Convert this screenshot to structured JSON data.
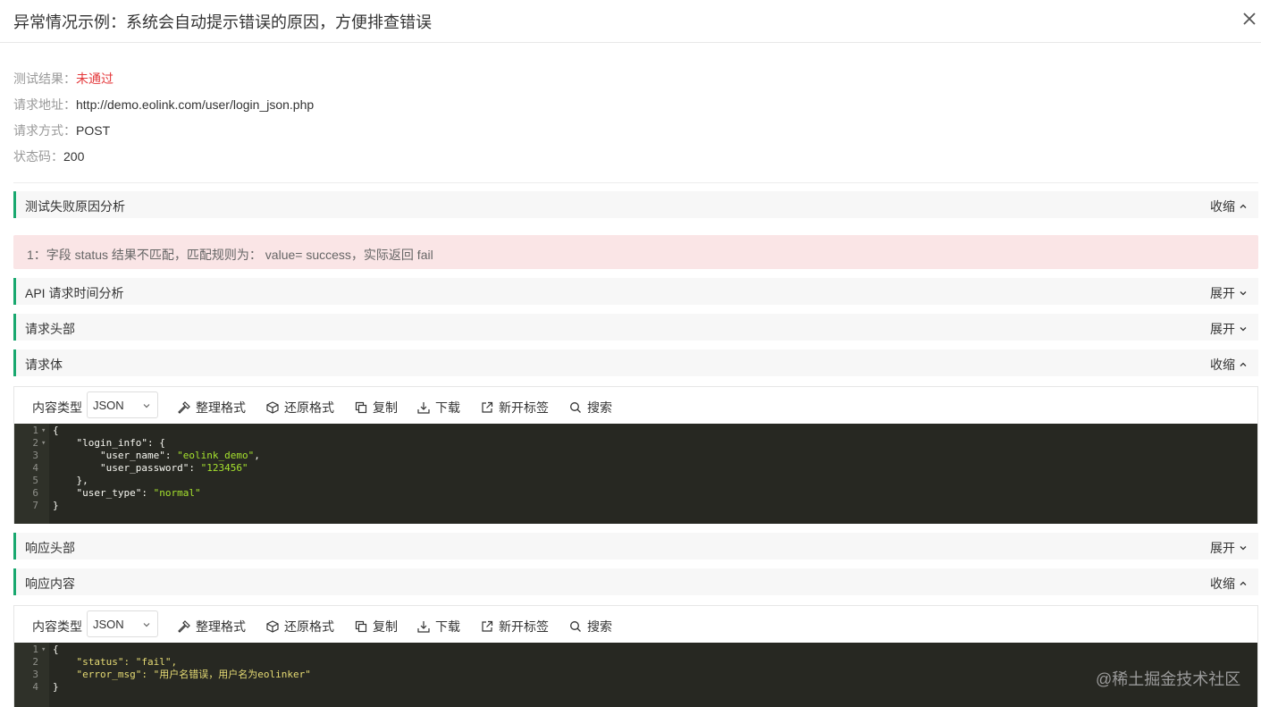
{
  "dialog": {
    "title": "异常情况示例：系统会自动提示错误的原因，方便排查错误"
  },
  "info": {
    "result_key": "测试结果：",
    "result_value": "未通过",
    "url_key": "请求地址：",
    "url_value": "http://demo.eolink.com/user/login_json.php",
    "method_key": "请求方式：",
    "method_value": "POST",
    "status_key": "状态码：",
    "status_value": "200"
  },
  "sections": {
    "failure": {
      "label": "测试失败原因分析",
      "toggle": "收缩"
    },
    "timing": {
      "label": "API 请求时间分析",
      "toggle": "展开"
    },
    "req_headers": {
      "label": "请求头部",
      "toggle": "展开"
    },
    "req_body": {
      "label": "请求体",
      "toggle": "收缩"
    },
    "resp_headers": {
      "label": "响应头部",
      "toggle": "展开"
    },
    "resp_body": {
      "label": "响应内容",
      "toggle": "收缩"
    }
  },
  "failure_message": "1：字段 status 结果不匹配，匹配规则为： value= success，实际返回 fail",
  "toolbar": {
    "content_type_label": "内容类型",
    "content_type_value": "JSON",
    "format": "整理格式",
    "restore": "还原格式",
    "copy": "复制",
    "download": "下载",
    "new_tab": "新开标签",
    "search": "搜索"
  },
  "request_code": {
    "line_numbers": [
      "1",
      "2",
      "3",
      "4",
      "5",
      "6",
      "7"
    ],
    "l1": "{",
    "l2_key": "\"login_info\"",
    "l2_rest": ": {",
    "l3_key": "\"user_name\"",
    "l3_val": "\"eolink_demo\"",
    "l4_key": "\"user_password\"",
    "l4_val": "\"123456\"",
    "l5": "},",
    "l6_key": "\"user_type\"",
    "l6_val": "\"normal\"",
    "l7": "}"
  },
  "response_code": {
    "line_numbers": [
      "1",
      "2",
      "3",
      "4"
    ],
    "l1": "{",
    "l2_key": "\"status\"",
    "l2_val": "\"fail\"",
    "l3_key": "\"error_msg\"",
    "l3_val": "\"用户名错误，用户名为eolinker\"",
    "l4": "}"
  },
  "watermark": "@稀土掘金技术社区",
  "colors": {
    "accent": "#19a86f",
    "fail_text": "#e4393c",
    "alert_bg": "#fae5e6",
    "code_bg": "#272822"
  }
}
